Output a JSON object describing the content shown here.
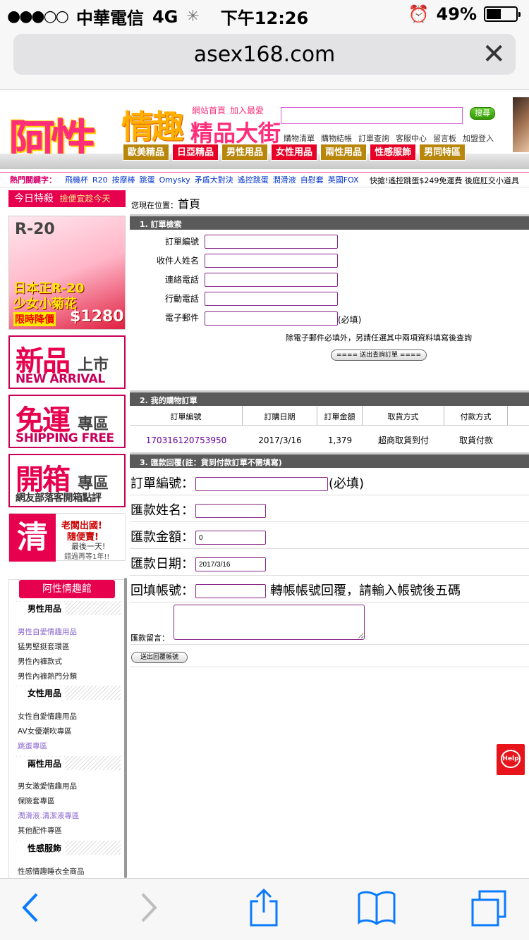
{
  "status": {
    "carrier": "中華電信",
    "network": "4G",
    "time": "下午12:26",
    "battery": "49%",
    "battery_level": 0.49
  },
  "browser": {
    "url": "asex168.com"
  },
  "header": {
    "logo_main": "阿性",
    "logo_sub1": "情趣",
    "logo_sub2": "精品大街",
    "home_link": "網站首頁",
    "fav_link": "加入最愛",
    "search_button": "搜尋",
    "search_placeholder": "",
    "sublinks": [
      "購物清單",
      "購物結帳",
      "訂單查詢",
      "客服中心",
      "留言板",
      "加盟登入"
    ],
    "categories": [
      "歐美精品",
      "日亞精品",
      "男性用品",
      "女性用品",
      "兩性用品",
      "性感服飾",
      "男同特區"
    ]
  },
  "keywords": {
    "label": "熱門關鍵字：",
    "items": [
      "飛機杯",
      "R20",
      "按摩棒",
      "跳蛋",
      "Omysky",
      "矛盾大對決",
      "遙控跳蛋",
      "潤滑液",
      "自慰套",
      "英國FOX"
    ],
    "ticker": "快搶!遙控跳蛋$249免運費 後庭肛交小道具"
  },
  "sidebar": {
    "today_sale": "今日特殺",
    "today_sale_sub": "撿便宜趁今天",
    "promo": {
      "brand": "R-20",
      "line1": "日本正R-20",
      "line2": "少女小菊花",
      "line3": "限時降價",
      "price": "$1280"
    },
    "banner_new": {
      "big": "新品",
      "mid": "上市",
      "en": "NEW ARRIVAL"
    },
    "banner_ship": {
      "big": "免運",
      "mid": "專區",
      "en": "SHIPPING FREE"
    },
    "banner_unbox": {
      "big": "開箱",
      "mid": "專區",
      "en": "網友部落客開箱點評"
    },
    "banner_clear": {
      "big": "清",
      "t1": "老闆出國!",
      "t2": "隨便賣!",
      "t3": "最後一天!",
      "t4": "錯過再等1年!!"
    },
    "mall_title": "阿性情趣館",
    "sections": [
      {
        "title": "男性用品",
        "items": [
          "男性自愛情趣用品",
          "猛男堅挺套環區",
          "男性內褲款式",
          "男性內褲熱門分類"
        ]
      },
      {
        "title": "女性用品",
        "items": [
          "女性自愛情趣用品",
          "AV女優潮吹專區",
          "跳蛋專區"
        ]
      },
      {
        "title": "兩性用品",
        "items": [
          "男女激愛情趣用品",
          "保險套專區",
          "潤滑液.清潔液專區",
          "其他配件專區"
        ]
      },
      {
        "title": "性感服飾",
        "items": [
          "性感情趣睡衣全商品"
        ]
      }
    ]
  },
  "main": {
    "breadcrumb_label": "您現在位置：",
    "breadcrumb_home": "首頁",
    "section1_title": "1. 訂單檢索",
    "fields1": [
      "訂單編號",
      "收件人姓名",
      "連絡電話",
      "行動電話",
      "電子郵件"
    ],
    "required_note": "(必填)",
    "search_hint": "除電子郵件必填外，另請任選其中兩項資料填寫後查詢",
    "submit_query": "==== 送出查詢訂單 ====",
    "section2_title": "2. 我的購物訂單",
    "order_headers": [
      "訂單編號",
      "訂購日期",
      "訂單金額",
      "取貨方式",
      "付款方式"
    ],
    "order_row": {
      "id": "170316120753950",
      "date": "2017/3/16",
      "amount": "1,379",
      "pickup": "超商取貨到付",
      "payment": "取貨付款"
    },
    "section3_title": "3. 匯款回覆(註：貨到付款訂單不需填寫)",
    "f3_order_label": "訂單編號：",
    "f3_required": "(必填)",
    "f3_name_label": "匯款姓名：",
    "f3_amount_label": "匯款金額：",
    "f3_amount_value": "0",
    "f3_date_label": "匯款日期：",
    "f3_date_value": "2017/3/16",
    "f3_account_label": "回填帳號：",
    "f3_account_hint": "轉帳帳號回覆，請輸入帳號後五碼",
    "f3_message_label": "匯款留言：",
    "submit_remit": "送出回覆帳號"
  },
  "help_label": "Help"
}
